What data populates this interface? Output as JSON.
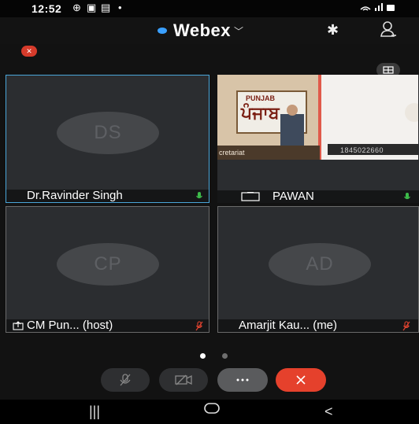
{
  "status_bar": {
    "time": "12:52"
  },
  "header": {
    "app_name": "Webex"
  },
  "tiles": [
    {
      "initials": "DS",
      "name": "Dr.Ravinder Singh",
      "mic": "unmuted"
    },
    {
      "name": "PAWAN",
      "mic": "unmuted",
      "video_caption_left": "cretariat",
      "video_caption_right": "1845022660",
      "video_sign": "PUNJAB",
      "video_sign_punjabi": "ਪੰਜਾਬ"
    },
    {
      "initials": "CP",
      "name": "CM Pun... (host)",
      "mic": "muted"
    },
    {
      "initials": "AD",
      "name": "Amarjit Kau... (me)",
      "mic": "muted"
    }
  ],
  "pager": {
    "pages": 2,
    "current": 1
  },
  "controls": [
    "mute-mic",
    "video-off",
    "more",
    "leave"
  ],
  "colors": {
    "accent": "#3aa0ff",
    "active_border": "#4aa6d9",
    "mic_on": "#3dbb4a",
    "mic_off": "#e0432f",
    "leave": "#e5412c"
  }
}
